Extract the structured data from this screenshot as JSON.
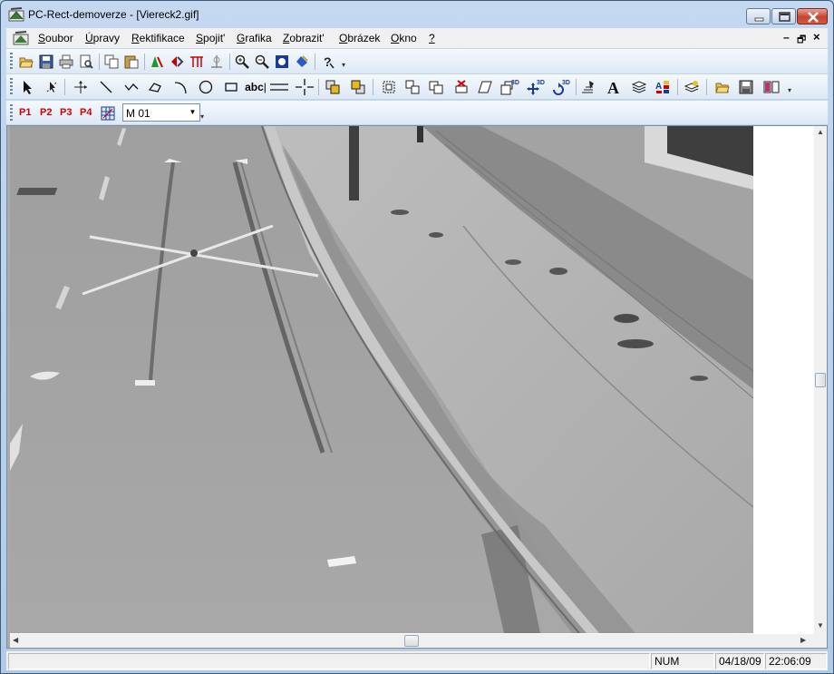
{
  "window": {
    "title": "PC-Rect-demoverze - [Viereck2.gif]"
  },
  "menu": {
    "items": [
      {
        "key": "S",
        "rest": "oubor"
      },
      {
        "key": "Ú",
        "rest": "pravy"
      },
      {
        "key": "R",
        "rest": "ektifikace"
      },
      {
        "key": "S",
        "rest": "pojit'"
      },
      {
        "key": "G",
        "rest": "rafika"
      },
      {
        "key": "Z",
        "rest": "obrazit'"
      },
      {
        "key": "O",
        "rest": "brázek"
      },
      {
        "key": "O",
        "rest": "kno"
      },
      {
        "key": "?",
        "rest": ""
      }
    ],
    "mdi_controls": [
      "–",
      "🗗",
      "×"
    ]
  },
  "toolbar3": {
    "points": [
      "P1",
      "P2",
      "P3",
      "P4"
    ],
    "model_select": "M 01",
    "text_tool": "abc"
  },
  "status": {
    "num": "NUM",
    "date": "04/18/09",
    "time": "22:06:09"
  },
  "colors": {
    "accent_red": "#d40000",
    "window_frame": "#b9d1ea"
  }
}
